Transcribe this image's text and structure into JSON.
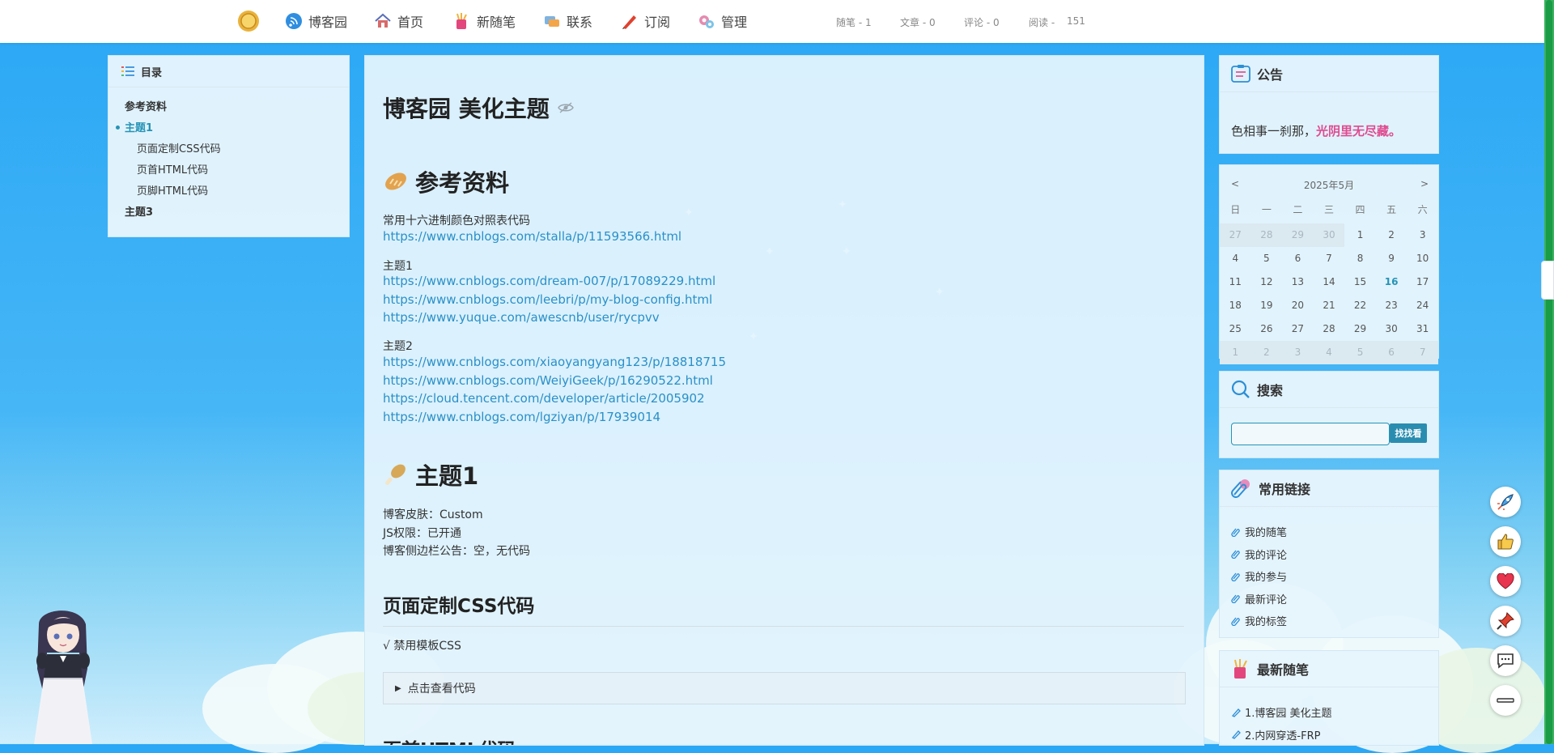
{
  "nav": {
    "items": [
      {
        "label": "博客园",
        "icon": "rss-icon"
      },
      {
        "label": "首页",
        "icon": "home-icon"
      },
      {
        "label": "新随笔",
        "icon": "pencil-cup-icon"
      },
      {
        "label": "联系",
        "icon": "contact-icon"
      },
      {
        "label": "订阅",
        "icon": "subscribe-pen-icon"
      },
      {
        "label": "管理",
        "icon": "gear-icon"
      }
    ],
    "stats": [
      "随笔 - 1",
      "文章 - 0",
      "评论 - 0",
      "阅读 -",
      "151"
    ]
  },
  "toc": {
    "title": "目录",
    "items": [
      "参考资料",
      "主题1",
      "页面定制CSS代码",
      "页首HTML代码",
      "页脚HTML代码",
      "主题3"
    ]
  },
  "post": {
    "title": "博客园 美化主题",
    "section1": "参考资料",
    "ref_label": "常用十六进制颜色对照表代码",
    "ref_link": "https://www.cnblogs.com/stalla/p/11593566.html",
    "t1_label": "主题1",
    "t1_links": [
      "https://www.cnblogs.com/dream-007/p/17089229.html",
      "https://www.cnblogs.com/leebri/p/my-blog-config.html",
      "https://www.yuque.com/awescnb/user/rycpvv"
    ],
    "t2_label": "主题2",
    "t2_links": [
      "https://www.cnblogs.com/xiaoyangyang123/p/18818715",
      "https://www.cnblogs.com/WeiyiGeek/p/16290522.html",
      "https://cloud.tencent.com/developer/article/2005902",
      "https://www.cnblogs.com/lgziyan/p/17939014"
    ],
    "section2": "主题1",
    "s2_lines": [
      "博客皮肤：Custom",
      "JS权限：已开通",
      "博客侧边栏公告：空，无代码"
    ],
    "section3": "页面定制CSS代码",
    "s3_line": "√ 禁用模板CSS",
    "details": "点击查看代码",
    "section4": "页首HTML代码"
  },
  "notice": {
    "title": "公告",
    "text": "色相事一刹那，",
    "highlight": "光阴里无尽藏。"
  },
  "calendar": {
    "prev": "<",
    "next": ">",
    "month": "2025年5月",
    "dow": [
      "日",
      "一",
      "二",
      "三",
      "四",
      "五",
      "六"
    ],
    "weeks": [
      [
        "27",
        "28",
        "29",
        "30",
        "1",
        "2",
        "3"
      ],
      [
        "4",
        "5",
        "6",
        "7",
        "8",
        "9",
        "10"
      ],
      [
        "11",
        "12",
        "13",
        "14",
        "15",
        "16",
        "17"
      ],
      [
        "18",
        "19",
        "20",
        "21",
        "22",
        "23",
        "24"
      ],
      [
        "25",
        "26",
        "27",
        "28",
        "29",
        "30",
        "31"
      ],
      [
        "1",
        "2",
        "3",
        "4",
        "5",
        "6",
        "7"
      ]
    ],
    "today": "16"
  },
  "search": {
    "title": "搜索",
    "button": "找找看",
    "value": ""
  },
  "links": {
    "title": "常用链接",
    "items": [
      "我的随笔",
      "我的评论",
      "我的参与",
      "最新评论",
      "我的标签"
    ]
  },
  "recent": {
    "title": "最新随笔",
    "items": [
      "1.博客园 美化主题",
      "2.内网穿透-FRP"
    ]
  },
  "fabs": [
    "rocket-icon",
    "thumbs-up-icon",
    "heart-icon",
    "pin-icon",
    "comment-icon",
    "minus-icon"
  ],
  "colors": {
    "sky": "#2aa7f5",
    "accent": "#2693b5",
    "link": "#2a90c8",
    "pink": "#e04b8f"
  }
}
